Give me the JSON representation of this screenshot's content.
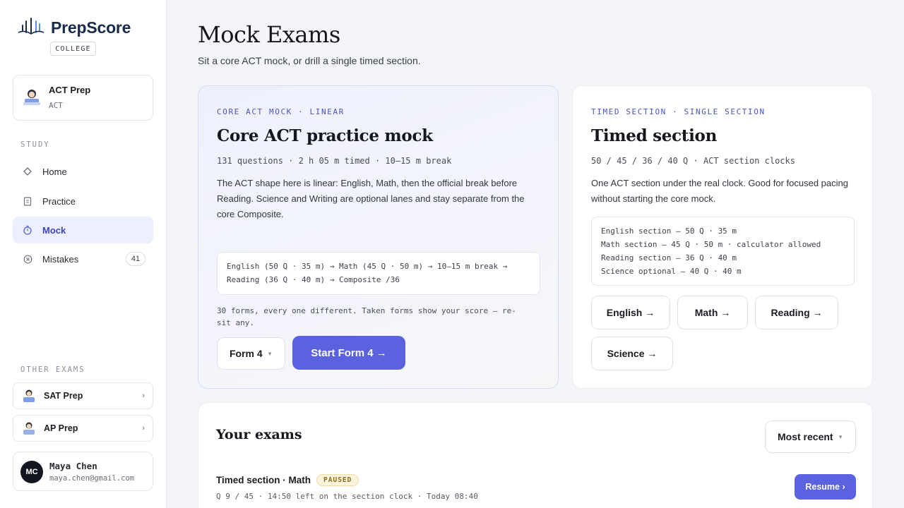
{
  "brand": {
    "name": "PrepScore",
    "badge": "COLLEGE"
  },
  "course": {
    "title": "ACT Prep",
    "subtitle": "ACT"
  },
  "sidebar": {
    "study_label": "STUDY",
    "items": [
      {
        "label": "Home",
        "icon": "diamond-icon"
      },
      {
        "label": "Practice",
        "icon": "document-icon"
      },
      {
        "label": "Mock",
        "icon": "stopwatch-icon",
        "active": true
      },
      {
        "label": "Mistakes",
        "icon": "x-circle-icon",
        "count": "41"
      }
    ],
    "other_label": "OTHER EXAMS",
    "other_exams": [
      {
        "label": "SAT Prep"
      },
      {
        "label": "AP Prep"
      }
    ]
  },
  "user": {
    "initials": "MC",
    "name": "Maya Chen",
    "email": "maya.chen@gmail.com"
  },
  "page": {
    "title": "Mock Exams",
    "subtitle": "Sit a core ACT mock, or drill a single timed section."
  },
  "core": {
    "eyebrow": "CORE ACT MOCK · LINEAR",
    "title": "Core ACT practice mock",
    "meta": "131 questions · 2 h 05 m timed · 10–15 m break",
    "description": "The ACT shape here is linear: English, Math, then the official break before Reading. Science and Writing are optional lanes and stay separate from the core Composite.",
    "flow_line1": "English (50 Q · 35 m) → Math (45 Q · 50 m) → 10–15 m break →",
    "flow_line2": "Reading (36 Q · 40 m) → Composite /36",
    "forms_note": "30 forms, every one different. Taken forms show your score — re-sit any.",
    "form_select": "Form 4",
    "start_button": "Start Form 4 →"
  },
  "timed": {
    "eyebrow": "TIMED SECTION · SINGLE SECTION",
    "title": "Timed section",
    "meta": "50 / 45 / 36 / 40 Q · ACT section clocks",
    "description": "One ACT section under the real clock. Good for focused pacing without starting the core mock.",
    "lines": [
      "English section — 50 Q · 35 m",
      "Math section — 45 Q · 50 m · calculator allowed",
      "Reading section — 36 Q · 40 m",
      "Science optional — 40 Q · 40 m"
    ],
    "buttons": [
      "English →",
      "Math →",
      "Reading →",
      "Science →"
    ]
  },
  "exams": {
    "title": "Your exams",
    "sort": "Most recent",
    "row": {
      "title": "Timed section · Math",
      "status": "PAUSED",
      "meta": "Q 9 / 45 · 14:50 left on the section clock · Today 08:40",
      "action": "Resume ›"
    }
  },
  "colors": {
    "accent": "#5a62e0",
    "active_bg": "#eceffd",
    "paused_bg": "#fbf3dc"
  }
}
